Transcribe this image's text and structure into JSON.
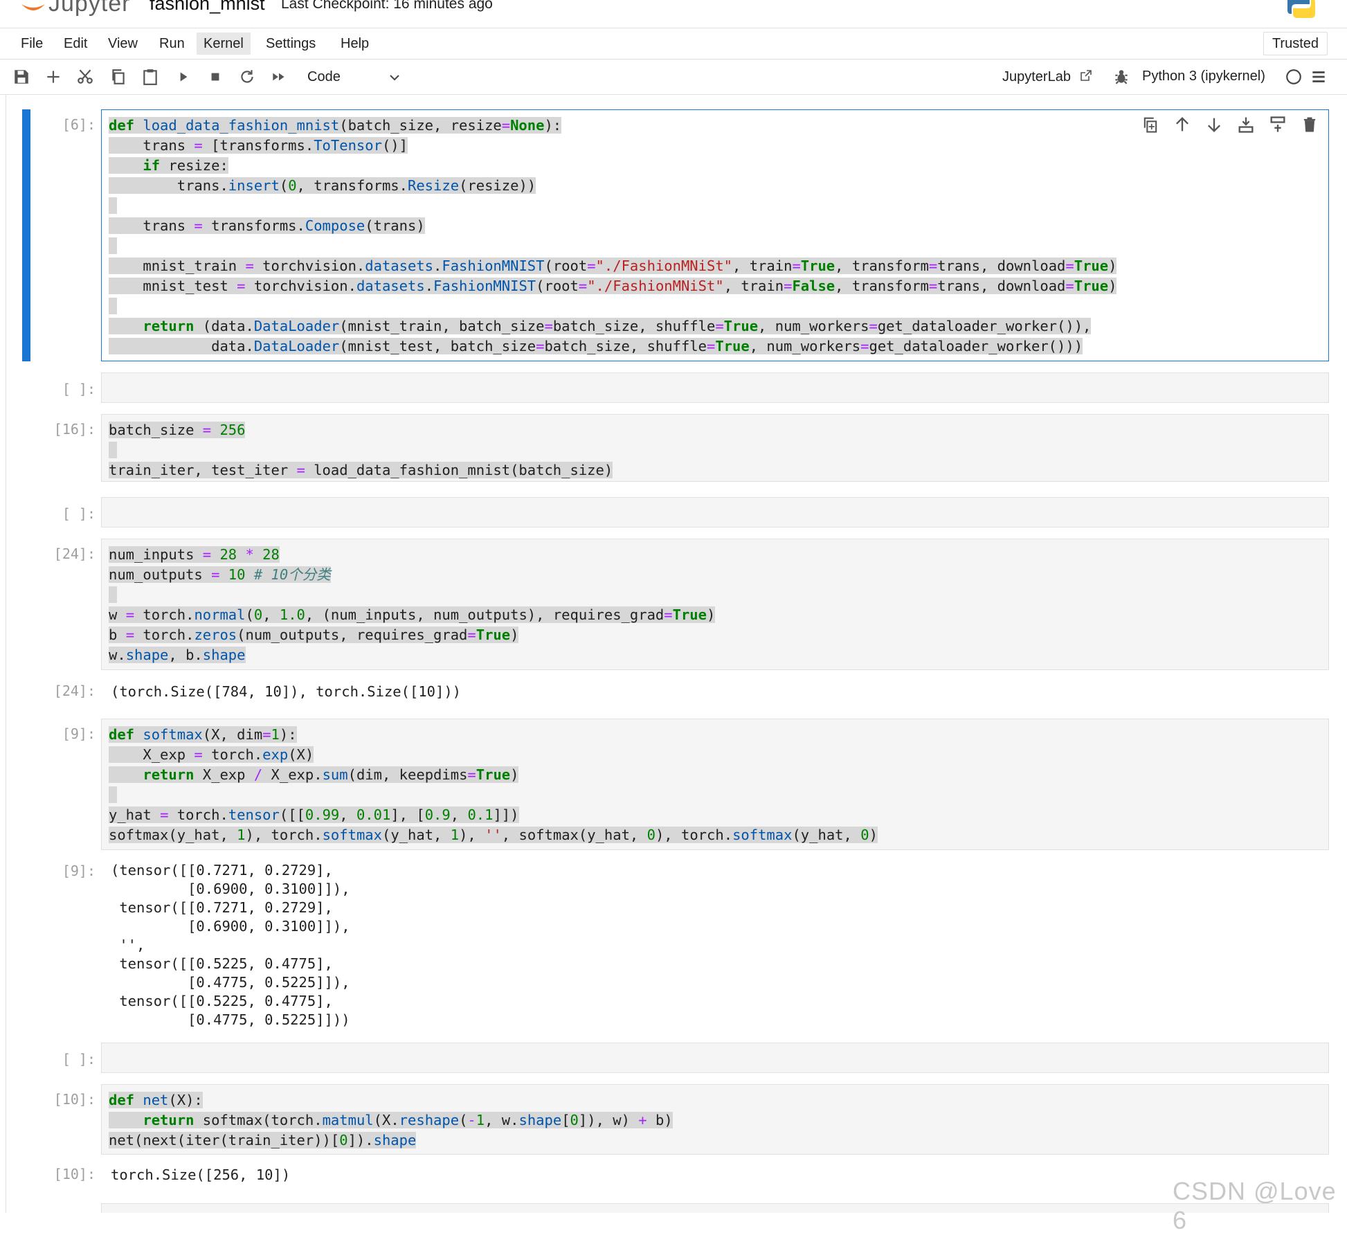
{
  "header": {
    "logo_text": "Jupyter",
    "notebook_name": "fashion_mnist",
    "checkpoint": "Last Checkpoint: 16 minutes ago"
  },
  "menu": [
    "File",
    "Edit",
    "View",
    "Run",
    "Kernel",
    "Settings",
    "Help"
  ],
  "menu_active": "Kernel",
  "trusted_label": "Trusted",
  "toolbar": {
    "cell_type": "Code",
    "jupyterlab_label": "JupyterLab",
    "kernel_label": "Python 3 (ipykernel)",
    "icons": [
      "save-icon",
      "add-icon",
      "cut-icon",
      "copy-icon",
      "paste-icon",
      "run-icon",
      "stop-icon",
      "restart-icon",
      "fast-forward-icon",
      "external-link-icon",
      "bug-icon",
      "kernel-status-icon",
      "menu-icon"
    ]
  },
  "cell_toolbar_icons": [
    "duplicate-icon",
    "move-up-icon",
    "move-down-icon",
    "insert-below-icon",
    "insert-above-icon",
    "delete-icon"
  ],
  "cells": {
    "c1_prompt": "[6]:",
    "c2_prompt": "[ ]:",
    "c3_prompt": "[16]:",
    "c4_prompt": "[ ]:",
    "c5_prompt": "[24]:",
    "c5_out_prompt": "[24]:",
    "c5_output": "(torch.Size([784, 10]), torch.Size([10]))",
    "c6_prompt": "[9]:",
    "c6_out_prompt": "[9]:",
    "c6_output": "(tensor([[0.7271, 0.2729],\n         [0.6900, 0.3100]]),\n tensor([[0.7271, 0.2729],\n         [0.6900, 0.3100]]),\n '',\n tensor([[0.5225, 0.4775],\n         [0.4775, 0.5225]]),\n tensor([[0.5225, 0.4775],\n         [0.4775, 0.5225]]))",
    "c7_prompt": "[ ]:",
    "c8_prompt": "[10]:",
    "c8_out_prompt": "[10]:",
    "c8_output": "torch.Size([256, 10])",
    "c9_prompt": "[ ]:"
  },
  "code": {
    "c1": [
      "def load_data_fashion_mnist(batch_size, resize=None):",
      "    trans = [transforms.ToTensor()]",
      "    if resize:",
      "        trans.insert(0, transforms.Resize(resize))",
      "",
      "    trans = transforms.Compose(trans)",
      "",
      "    mnist_train = torchvision.datasets.FashionMNIST(root=\"./FashionMNiSt\", train=True, transform=trans, download=True)",
      "    mnist_test = torchvision.datasets.FashionMNIST(root=\"./FashionMNiSt\", train=False, transform=trans, download=True)",
      "",
      "    return (data.DataLoader(mnist_train, batch_size=batch_size, shuffle=True, num_workers=get_dataloader_worker()),",
      "            data.DataLoader(mnist_test, batch_size=batch_size, shuffle=True, num_workers=get_dataloader_worker()))"
    ],
    "c3": [
      "batch_size = 256",
      "",
      "train_iter, test_iter = load_data_fashion_mnist(batch_size)"
    ],
    "c5": [
      "num_inputs = 28 * 28",
      "num_outputs = 10 # 10个分类",
      "",
      "w = torch.normal(0, 1.0, (num_inputs, num_outputs), requires_grad=True)",
      "b = torch.zeros(num_outputs, requires_grad=True)",
      "w.shape, b.shape"
    ],
    "c6": [
      "def softmax(X, dim=1):",
      "    X_exp = torch.exp(X)",
      "    return X_exp / X_exp.sum(dim, keepdims=True)",
      "",
      "y_hat = torch.tensor([[0.99, 0.01], [0.9, 0.1]])",
      "softmax(y_hat, 1), torch.softmax(y_hat, 1), '', softmax(y_hat, 0), torch.softmax(y_hat, 0)"
    ],
    "c8": [
      "def net(X):",
      "    return softmax(torch.matmul(X.reshape(-1, w.shape[0]), w) + b)",
      "net(next(iter(train_iter))[0]).shape"
    ]
  },
  "watermark": "CSDN @Love 6",
  "colors": {
    "accent": "#1976d2",
    "keyword": "#008000",
    "string": "#ba2121",
    "function": "#0055aa",
    "jupyter_orange": "#f37626"
  }
}
